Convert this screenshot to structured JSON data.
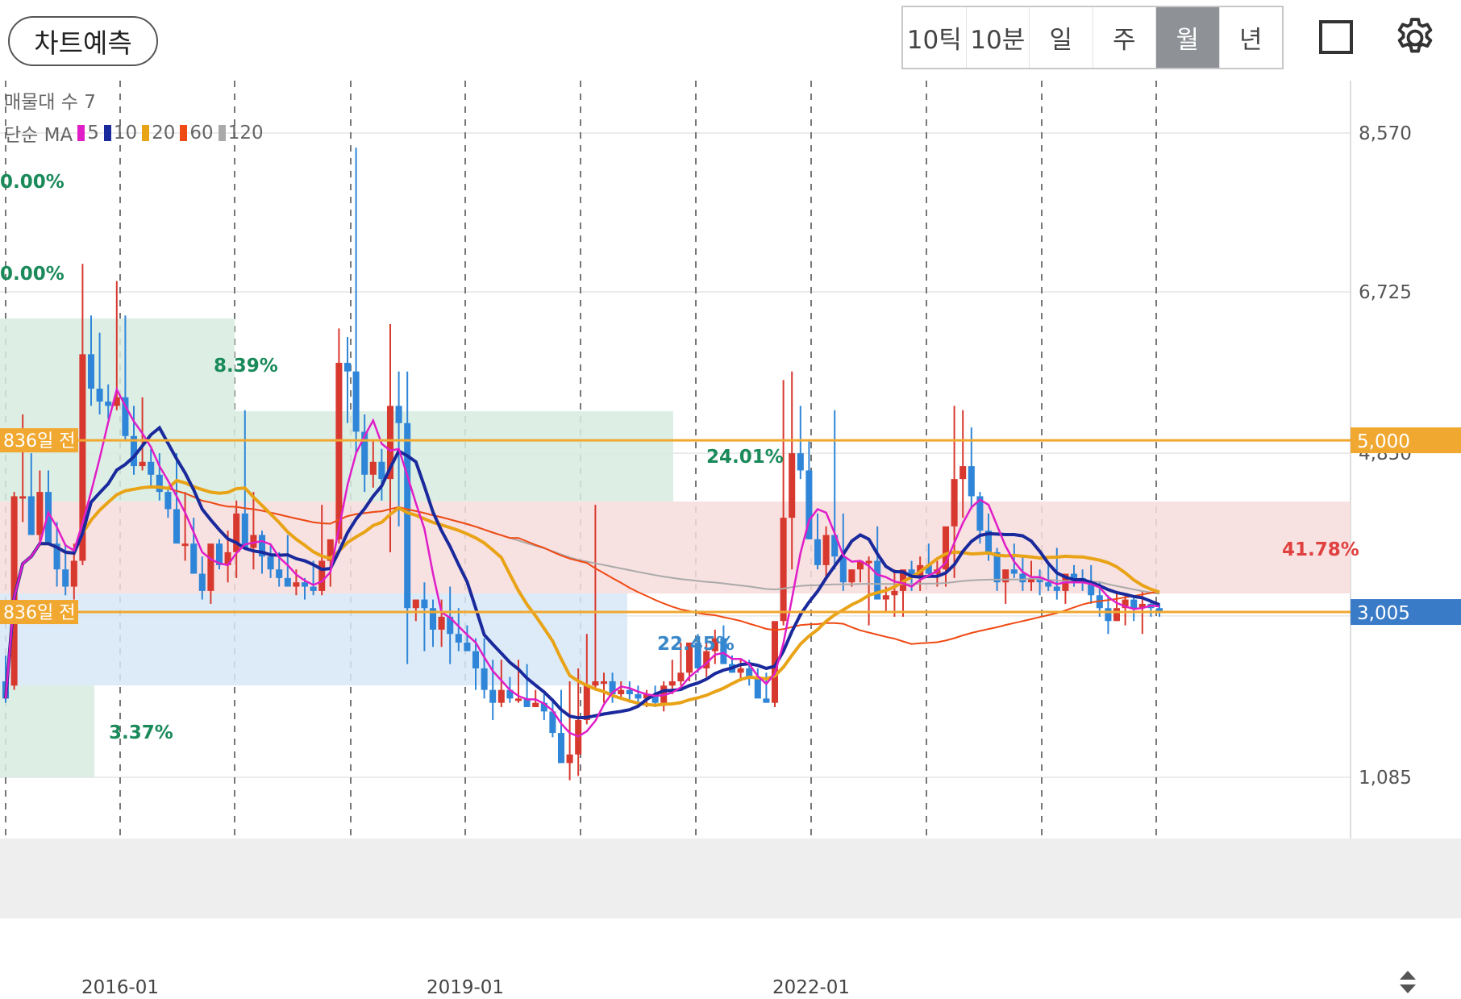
{
  "toolbar": {
    "predict_label": "차트예측",
    "periods": [
      "10틱",
      "10분",
      "일",
      "주",
      "월",
      "년"
    ],
    "active_period": "월"
  },
  "legend": {
    "volume_profile": "매물대 수 7",
    "ma_prefix": "단순 MA",
    "ma_items": [
      {
        "label": "5",
        "color": "#e01ec8"
      },
      {
        "label": "10",
        "color": "#1a2a9c"
      },
      {
        "label": "20",
        "color": "#e8a317"
      },
      {
        "label": "60",
        "color": "#f04a14"
      },
      {
        "label": "120",
        "color": "#aaaaaa"
      }
    ]
  },
  "chart_data": {
    "type": "candlestick",
    "y_ticks": [
      "8,570",
      "6,725",
      "4,850",
      "1,085"
    ],
    "x_ticks": [
      "2016-01",
      "2019-01",
      "2022-01"
    ],
    "price_tags": [
      {
        "value": 5000,
        "label": "5,000",
        "color": "#f0a830"
      },
      {
        "value": 3005,
        "label": "3,005",
        "color": "#3a7bc8"
      }
    ],
    "line_labels": [
      "836일 전",
      "836일 전"
    ],
    "percent_labels": [
      {
        "text": "0.00%",
        "color": "#1a8a5a"
      },
      {
        "text": "0.00%",
        "color": "#1a8a5a"
      },
      {
        "text": "8.39%",
        "color": "#1a8a5a"
      },
      {
        "text": "24.01%",
        "color": "#1a8a5a"
      },
      {
        "text": "22.45%",
        "color": "#3a88c8"
      },
      {
        "text": "3.37%",
        "color": "#1a8a5a"
      },
      {
        "text": "41.78%",
        "color": "#e04040"
      }
    ],
    "candles": [
      [
        2200,
        2500,
        1950,
        2000
      ],
      [
        2150,
        4400,
        2100,
        4350
      ],
      [
        4350,
        5300,
        4050,
        4350
      ],
      [
        4350,
        4850,
        3900,
        3900
      ],
      [
        3900,
        4650,
        3800,
        4400
      ],
      [
        4400,
        4650,
        3850,
        3800
      ],
      [
        3800,
        4050,
        3300,
        3500
      ],
      [
        3500,
        3800,
        3200,
        3300
      ],
      [
        3300,
        3800,
        3150,
        3600
      ],
      [
        3600,
        7050,
        3550,
        6000
      ],
      [
        6000,
        6450,
        5400,
        5600
      ],
      [
        5600,
        6250,
        5300,
        5450
      ],
      [
        5450,
        5650,
        5250,
        5400
      ],
      [
        5400,
        6850,
        5350,
        5500
      ],
      [
        5500,
        6450,
        5000,
        5050
      ],
      [
        5050,
        5400,
        4600,
        4700
      ],
      [
        4700,
        5500,
        4650,
        4750
      ],
      [
        4750,
        4900,
        4450,
        4600
      ],
      [
        4600,
        4850,
        4300,
        4400
      ],
      [
        4400,
        4450,
        4100,
        4200
      ],
      [
        4200,
        4850,
        3850,
        3800
      ],
      [
        3800,
        4400,
        3600,
        3800
      ],
      [
        3800,
        4100,
        3500,
        3450
      ],
      [
        3450,
        3650,
        3150,
        3250
      ],
      [
        3250,
        3700,
        3100,
        3800
      ],
      [
        3800,
        3850,
        3500,
        3550
      ],
      [
        3550,
        3950,
        3350,
        3700
      ],
      [
        3700,
        4300,
        3400,
        4150
      ],
      [
        4150,
        5350,
        4050,
        3750
      ],
      [
        3750,
        4400,
        3500,
        3900
      ],
      [
        3900,
        3950,
        3450,
        3650
      ],
      [
        3650,
        3800,
        3400,
        3500
      ],
      [
        3500,
        3700,
        3300,
        3400
      ],
      [
        3400,
        3900,
        3300,
        3300
      ],
      [
        3300,
        3500,
        3200,
        3350
      ],
      [
        3350,
        3400,
        3150,
        3300
      ],
      [
        3300,
        3600,
        3200,
        3250
      ],
      [
        3250,
        4250,
        3200,
        3600
      ],
      [
        3600,
        3700,
        3300,
        3850
      ],
      [
        3850,
        6300,
        3800,
        5900
      ],
      [
        5900,
        6200,
        5200,
        5800
      ],
      [
        5800,
        8400,
        4850,
        5100
      ],
      [
        5100,
        5300,
        4400,
        4600
      ],
      [
        4600,
        5000,
        4450,
        4750
      ],
      [
        4750,
        4900,
        4300,
        4550
      ],
      [
        4550,
        6350,
        3700,
        5400
      ],
      [
        5400,
        5800,
        4000,
        5200
      ],
      [
        5200,
        5800,
        2400,
        3050
      ],
      [
        3050,
        3150,
        2900,
        3150
      ],
      [
        3150,
        3350,
        2550,
        3050
      ],
      [
        3050,
        3150,
        2600,
        2800
      ],
      [
        2800,
        3150,
        2600,
        2950
      ],
      [
        2950,
        3300,
        2400,
        2750
      ],
      [
        2750,
        3050,
        2550,
        2650
      ],
      [
        2650,
        2850,
        2550,
        2550
      ],
      [
        2550,
        2700,
        2100,
        2350
      ],
      [
        2350,
        2700,
        2000,
        2100
      ],
      [
        2100,
        2450,
        1750,
        1950
      ],
      [
        1950,
        2450,
        1900,
        2100
      ],
      [
        2100,
        2250,
        1950,
        2000
      ],
      [
        2000,
        2450,
        1950,
        2000
      ],
      [
        2000,
        2400,
        1950,
        1900
      ],
      [
        1900,
        2100,
        1900,
        1950
      ],
      [
        1950,
        2050,
        1750,
        1850
      ],
      [
        1850,
        2000,
        1550,
        1600
      ],
      [
        1600,
        2100,
        1300,
        1250
      ],
      [
        1250,
        2200,
        1050,
        1350
      ],
      [
        1350,
        2350,
        1100,
        1750
      ],
      [
        1750,
        2750,
        1700,
        2150
      ],
      [
        2150,
        4250,
        2100,
        2200
      ],
      [
        2200,
        2300,
        1950,
        2200
      ],
      [
        2200,
        2300,
        1950,
        2050
      ],
      [
        2050,
        2200,
        2000,
        2100
      ],
      [
        2100,
        2200,
        1950,
        2050
      ],
      [
        2050,
        2150,
        1900,
        2000
      ],
      [
        2000,
        2100,
        1900,
        2050
      ],
      [
        2050,
        2150,
        1900,
        1950
      ],
      [
        1950,
        2200,
        1850,
        2150
      ],
      [
        2150,
        2450,
        2050,
        2200
      ],
      [
        2200,
        2650,
        2150,
        2300
      ],
      [
        2300,
        2450,
        2200,
        2650
      ],
      [
        2650,
        2750,
        2300,
        2350
      ],
      [
        2350,
        2650,
        2250,
        2550
      ],
      [
        2550,
        2800,
        2400,
        2700
      ],
      [
        2700,
        2850,
        2550,
        2400
      ],
      [
        2400,
        2500,
        2300,
        2300
      ],
      [
        2300,
        2450,
        2200,
        2350
      ],
      [
        2350,
        2450,
        2150,
        2250
      ],
      [
        2250,
        2350,
        2050,
        2000
      ],
      [
        2000,
        2300,
        1950,
        1950
      ],
      [
        1950,
        2650,
        1900,
        2900
      ],
      [
        2900,
        5700,
        2850,
        4100
      ],
      [
        4100,
        5800,
        3500,
        4850
      ],
      [
        4850,
        5400,
        4550,
        4650
      ],
      [
        4650,
        5000,
        3850,
        3850
      ],
      [
        3850,
        4150,
        3500,
        3550
      ],
      [
        3550,
        4000,
        3400,
        3900
      ],
      [
        3900,
        5350,
        3500,
        3650
      ],
      [
        3650,
        4150,
        3250,
        3350
      ],
      [
        3350,
        3500,
        3300,
        3500
      ],
      [
        3500,
        3600,
        3350,
        3600
      ],
      [
        3600,
        3650,
        2850,
        3600
      ],
      [
        3600,
        4000,
        3300,
        3150
      ],
      [
        3150,
        3300,
        3000,
        3200
      ],
      [
        3200,
        3500,
        2950,
        3250
      ],
      [
        3250,
        3350,
        2950,
        3500
      ],
      [
        3500,
        3600,
        3250,
        3400
      ],
      [
        3400,
        3650,
        3250,
        3550
      ],
      [
        3550,
        3800,
        3400,
        3450
      ],
      [
        3450,
        3600,
        3300,
        3500
      ],
      [
        3500,
        3850,
        3300,
        4000
      ],
      [
        4000,
        5400,
        3400,
        4550
      ],
      [
        4550,
        5350,
        4100,
        4700
      ],
      [
        4700,
        5150,
        4200,
        4350
      ],
      [
        4350,
        4400,
        3800,
        3950
      ],
      [
        3950,
        4150,
        3600,
        3700
      ],
      [
        3700,
        3750,
        3250,
        3350
      ],
      [
        3350,
        3500,
        3100,
        3500
      ],
      [
        3500,
        3800,
        3400,
        3450
      ],
      [
        3450,
        3650,
        3250,
        3350
      ],
      [
        3350,
        3600,
        3250,
        3400
      ],
      [
        3400,
        3500,
        3200,
        3350
      ],
      [
        3350,
        3550,
        3250,
        3300
      ],
      [
        3300,
        3750,
        3150,
        3250
      ],
      [
        3250,
        3350,
        3100,
        3450
      ],
      [
        3450,
        3550,
        3300,
        3400
      ],
      [
        3400,
        3500,
        3250,
        3350
      ],
      [
        3350,
        3550,
        3100,
        3200
      ],
      [
        3200,
        3350,
        2950,
        3050
      ],
      [
        3050,
        3200,
        2750,
        2900
      ],
      [
        2900,
        3250,
        2900,
        3050
      ],
      [
        3050,
        3200,
        2850,
        3150
      ],
      [
        3150,
        3200,
        2900,
        3050
      ],
      [
        3050,
        3250,
        2750,
        3100
      ],
      [
        3100,
        3150,
        2950,
        3050
      ],
      [
        3050,
        3100,
        2950,
        3000
      ]
    ]
  }
}
